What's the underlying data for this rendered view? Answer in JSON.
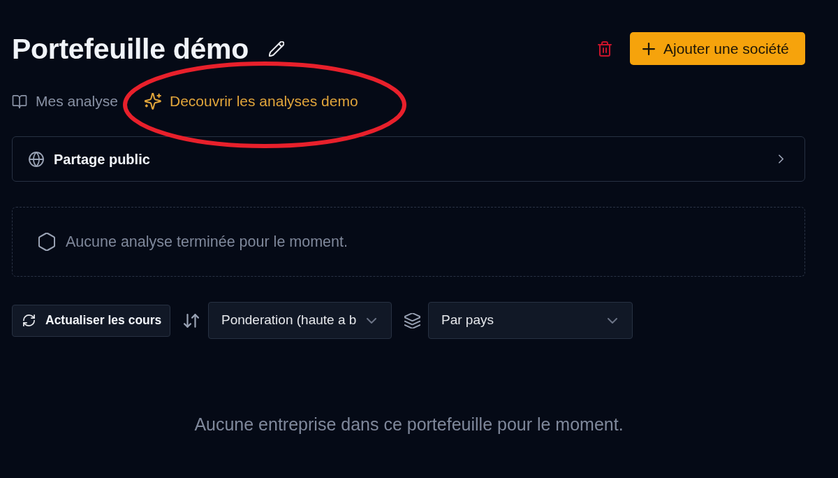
{
  "header": {
    "title": "Portefeuille démo",
    "add_button": "Ajouter une société"
  },
  "tabs": [
    {
      "label": "Mes analyse",
      "selected": false
    },
    {
      "label": "Decouvrir les analyses demo",
      "selected": true
    }
  ],
  "annotations": [
    {
      "kind": "ellipse"
    }
  ],
  "share_panel": {
    "label": "Partage public",
    "expanded": false
  },
  "analyses_empty": "Aucune analyse terminée pour le moment.",
  "toolbar": {
    "refresh_button": "Actualiser les cours",
    "sort_select": {
      "value": "Ponderation (haute a b"
    },
    "group_select": {
      "value": "Par pays"
    }
  },
  "empty_message": "Aucune entreprise dans ce portefeuille pour le moment."
}
